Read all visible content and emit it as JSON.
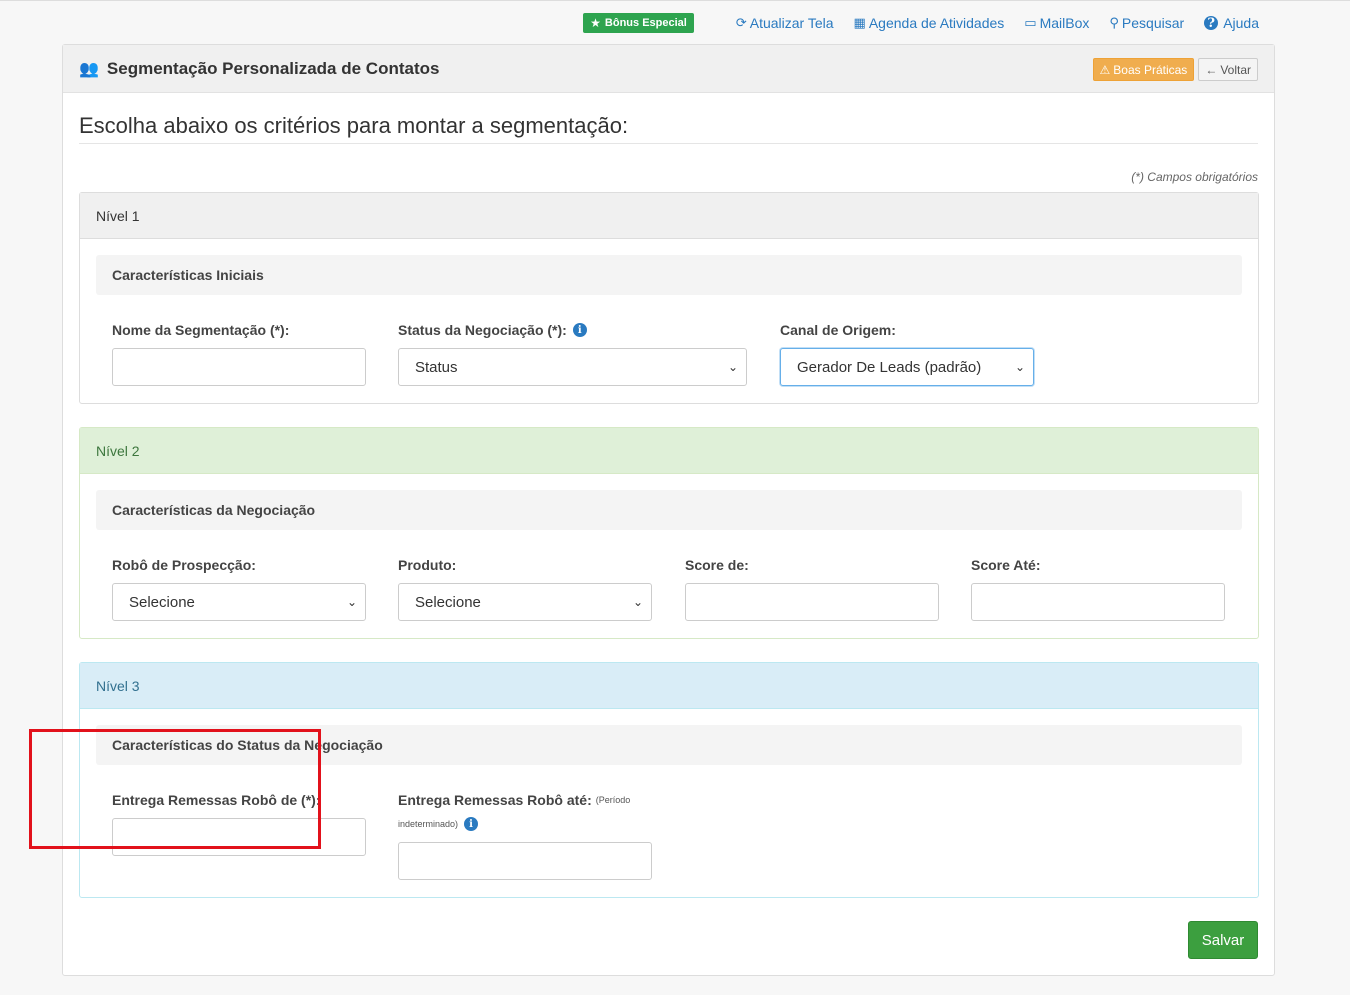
{
  "topnav": {
    "bonus": {
      "label": "Bônus Especial",
      "icon": "star-icon"
    },
    "links": [
      {
        "label": "Atualizar Tela",
        "icon": "refresh-icon",
        "glyph": "⟳"
      },
      {
        "label": "Agenda de Atividades",
        "icon": "calendar-icon",
        "glyph": "▦"
      },
      {
        "label": "MailBox",
        "icon": "mailbox-icon",
        "glyph": "▭"
      },
      {
        "label": "Pesquisar",
        "icon": "search-icon",
        "glyph": "⚲"
      },
      {
        "label": "Ajuda",
        "icon": "help-icon",
        "glyph": "?"
      }
    ]
  },
  "card": {
    "title": "Segmentação Personalizada de Contatos",
    "icon": "users-icon",
    "boas_praticas": "Boas Práticas",
    "voltar": "Voltar"
  },
  "intro": "Escolha abaixo os critérios para montar a segmentação:",
  "required_note": "(*) Campos obrigatórios",
  "nivel1": {
    "title": "Nível 1",
    "subhead": "Características Iniciais",
    "nome_label": "Nome da Segmentação (*):",
    "nome_value": "",
    "status_label": "Status da Negociação (*):",
    "status_value": "Status",
    "canal_label": "Canal de Origem:",
    "canal_value": "Gerador De Leads (padrão)"
  },
  "nivel2": {
    "title": "Nível 2",
    "subhead": "Características da Negociação",
    "robo_label": "Robô de Prospecção:",
    "robo_value": "Selecione",
    "produto_label": "Produto:",
    "produto_value": "Selecione",
    "score_de_label": "Score de:",
    "score_ate_label": "Score Até:"
  },
  "nivel3": {
    "title": "Nível 3",
    "subhead": "Características do Status da Negociação",
    "entrega_de_label": "Entrega Remessas Robô de (*):",
    "entrega_ate_label": "Entrega Remessas Robô até:",
    "entrega_ate_note_1": "(Período",
    "entrega_ate_note_2": "indeterminado)"
  },
  "save_label": "Salvar",
  "colors": {
    "accent": "#2a7ac0",
    "success": "#3c9f3f",
    "warning": "#f0ad4e",
    "highlight": "#e2111b"
  }
}
